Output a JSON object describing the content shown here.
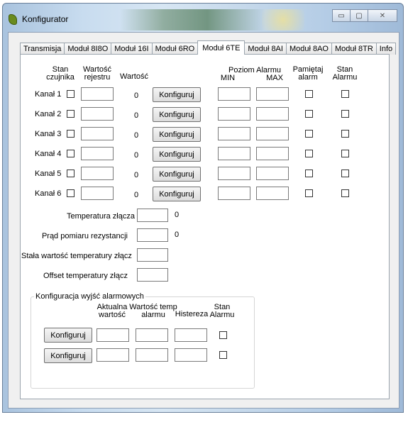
{
  "window": {
    "title": "Konfigurator",
    "minimize_glyph": "▭",
    "maximize_glyph": "▢",
    "close_glyph": "✕"
  },
  "tabs": [
    {
      "label": "Transmisja"
    },
    {
      "label": "Moduł 8I8O"
    },
    {
      "label": "Moduł 16I"
    },
    {
      "label": "Moduł 6RO"
    },
    {
      "label": "Moduł 6TE",
      "active": true
    },
    {
      "label": "Moduł 8AI"
    },
    {
      "label": "Moduł 8AO"
    },
    {
      "label": "Moduł 8TR"
    },
    {
      "label": "Info"
    }
  ],
  "headers": {
    "stan_czujnika_1": "Stan",
    "stan_czujnika_2": "czujnika",
    "wartosc_rejestru_1": "Wartość",
    "wartosc_rejestru_2": "rejestru",
    "wartosc": "Wartość",
    "poziom_alarmu": "Poziom Alarmu",
    "min": "MIN",
    "max": "MAX",
    "pamietaj_1": "Pamiętaj",
    "pamietaj_2": "alarm",
    "stan_alarmu_1": "Stan",
    "stan_alarmu_2": "Alarmu"
  },
  "channels": [
    {
      "label": "Kanał 1",
      "value": "0",
      "button": "Konfiguruj"
    },
    {
      "label": "Kanał 2",
      "value": "0",
      "button": "Konfiguruj"
    },
    {
      "label": "Kanał 3",
      "value": "0",
      "button": "Konfiguruj"
    },
    {
      "label": "Kanał 4",
      "value": "0",
      "button": "Konfiguruj"
    },
    {
      "label": "Kanał 5",
      "value": "0",
      "button": "Konfiguruj"
    },
    {
      "label": "Kanał 6",
      "value": "0",
      "button": "Konfiguruj"
    }
  ],
  "params": {
    "temp_label": "Temperatura złącza",
    "temp_value": "0",
    "current_label": "Prąd pomiaru rezystancji",
    "current_value": "0",
    "const_label": "Stała wartość temperatury złącz",
    "offset_label": "Offset temperatury złącz"
  },
  "alarm_outputs": {
    "title": "Konfiguracja wyjść alarmowych",
    "col_actual_1": "Aktualna",
    "col_actual_2": "wartość",
    "col_temp_1": "Wartość temp",
    "col_temp_2": "alarmu",
    "col_hyst": "Histereza",
    "col_state_1": "Stan",
    "col_state_2": "Alarmu",
    "rows": [
      {
        "button": "Konfiguruj"
      },
      {
        "button": "Konfiguruj"
      }
    ]
  }
}
